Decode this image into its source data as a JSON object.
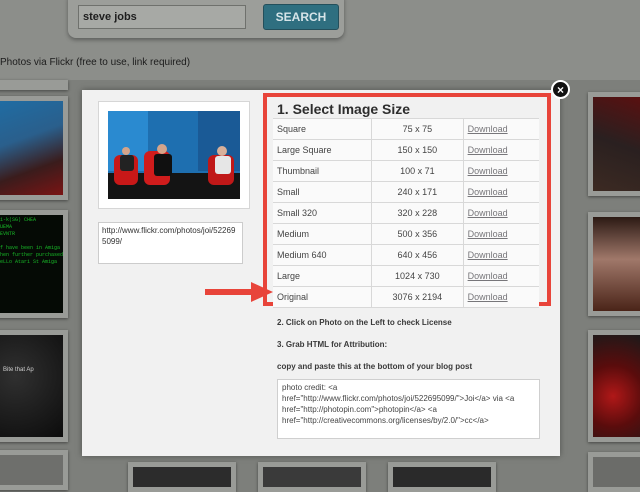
{
  "search": {
    "query": "steve jobs",
    "button_label": "SEARCH"
  },
  "subtitle": "Photos via Flickr (free to use, link required)",
  "modal": {
    "close_label": "×",
    "source_url": "http://www.flickr.com/photos/joi/522695099/",
    "step1_title": "1. Select Image Size",
    "sizes": [
      {
        "name": "Square",
        "dims": "75 x 75",
        "action": "Download"
      },
      {
        "name": "Large Square",
        "dims": "150 x 150",
        "action": "Download"
      },
      {
        "name": "Thumbnail",
        "dims": "100 x 71",
        "action": "Download"
      },
      {
        "name": "Small",
        "dims": "240 x 171",
        "action": "Download"
      },
      {
        "name": "Small 320",
        "dims": "320 x 228",
        "action": "Download"
      },
      {
        "name": "Medium",
        "dims": "500 x 356",
        "action": "Download"
      },
      {
        "name": "Medium 640",
        "dims": "640 x 456",
        "action": "Download"
      },
      {
        "name": "Large",
        "dims": "1024 x 730",
        "action": "Download"
      },
      {
        "name": "Original",
        "dims": "3076 x 2194",
        "action": "Download"
      }
    ],
    "step2": "2. Click on Photo on the Left to check License",
    "step3": "3. Grab HTML for Attribution:",
    "copy_instruction": "copy and paste this at the bottom of your blog post",
    "attribution_html": "photo credit: <a href=\"http://www.flickr.com/photos/joi/522695099/\">Joi</a> via <a href=\"http://photopin.com\">photopin</a> <a href=\"http://creativecommons.org/licenses/by/2.0/\">cc</a>"
  },
  "background": {
    "terminal_text": "ti-k(SG) CHEA\nRUEMA\nSEVNTR\n\nif have been in Amiga\nwhen further purchased\nHeLLo Atari St Amiga",
    "bite_text": "Bite that Ap"
  },
  "colors": {
    "accent_red": "#e8443a",
    "search_button": "#2f6f80"
  }
}
